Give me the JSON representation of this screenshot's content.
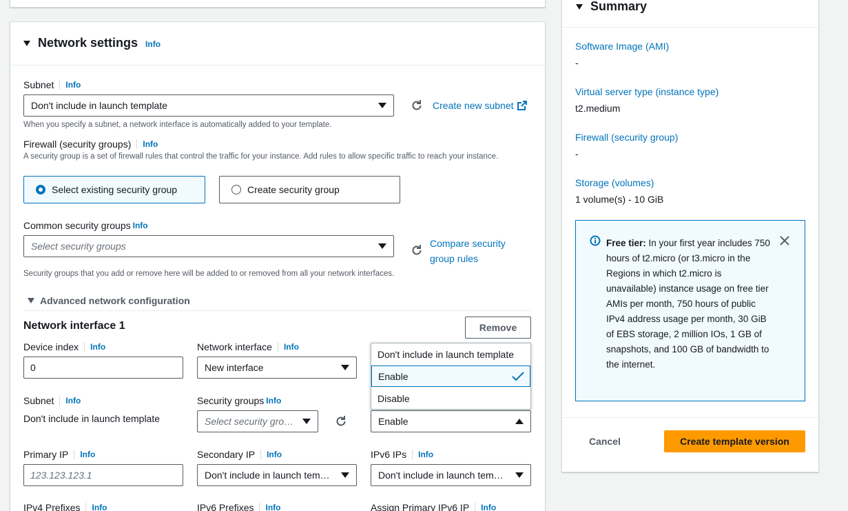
{
  "network": {
    "title": "Network settings",
    "info": "Info",
    "subnet_label": "Subnet",
    "subnet_value": "Don't include in launch template",
    "create_subnet_link": "Create new subnet",
    "subnet_hint": "When you specify a subnet, a network interface is automatically added to your template.",
    "firewall_label": "Firewall (security groups)",
    "firewall_hint": "A security group is a set of firewall rules that control the traffic for your instance. Add rules to allow specific traffic to reach your instance.",
    "radio_existing": "Select existing security group",
    "radio_create": "Create security group",
    "common_sg_label": "Common security groups",
    "common_sg_placeholder": "Select security groups",
    "compare_link_line1": "Compare security",
    "compare_link_line2": "group rules",
    "common_sg_hint": "Security groups that you add or remove here will be added to or removed from all your network interfaces.",
    "advanced_label": "Advanced network configuration"
  },
  "ni": {
    "title": "Network interface 1",
    "remove_button": "Remove",
    "device_index_label": "Device index",
    "device_index_value": "0",
    "network_interface_label": "Network interface",
    "network_interface_value": "New interface",
    "dropdown_options": [
      "Don't include in launch template",
      "Enable",
      "Disable"
    ],
    "dropdown_selected": "Enable",
    "subnet_label": "Subnet",
    "subnet_value": "Don't include in launch template",
    "sg_label": "Security groups",
    "sg_placeholder": "Select security groups",
    "primary_ip_label": "Primary IP",
    "primary_ip_placeholder": "123.123.123.1",
    "secondary_ip_label": "Secondary IP",
    "secondary_ip_value": "Don't include in launch tem…",
    "ipv6_ips_label": "IPv6 IPs",
    "ipv6_ips_value": "Don't include in launch tem…",
    "ipv4_prefixes_label": "IPv4 Prefixes",
    "ipv6_prefixes_label": "IPv6 Prefixes",
    "assign_primary_ipv6_label": "Assign Primary IPv6 IP"
  },
  "summary": {
    "title": "Summary",
    "ami_label": "Software Image (AMI)",
    "ami_value": "-",
    "instance_type_label": "Virtual server type (instance type)",
    "instance_type_value": "t2.medium",
    "firewall_label": "Firewall (security group)",
    "firewall_value": "-",
    "storage_label": "Storage (volumes)",
    "storage_value": "1 volume(s) - 10 GiB",
    "free_tier_bold": "Free tier:",
    "free_tier_text": "In your first year includes 750 hours of t2.micro (or t3.micro in the Regions in which t2.micro is unavailable) instance usage on free tier AMIs per month, 750 hours of public IPv4 address usage per month, 30 GiB of EBS storage, 2 million IOs, 1 GB of snapshots, and 100 GB of bandwidth to the internet.",
    "cancel_button": "Cancel",
    "create_button": "Create template version"
  },
  "colors": {
    "link": "#0073bb",
    "primary_button": "#ff9900",
    "info_box_bg": "#f1faff",
    "info_box_border": "#0073bb"
  }
}
